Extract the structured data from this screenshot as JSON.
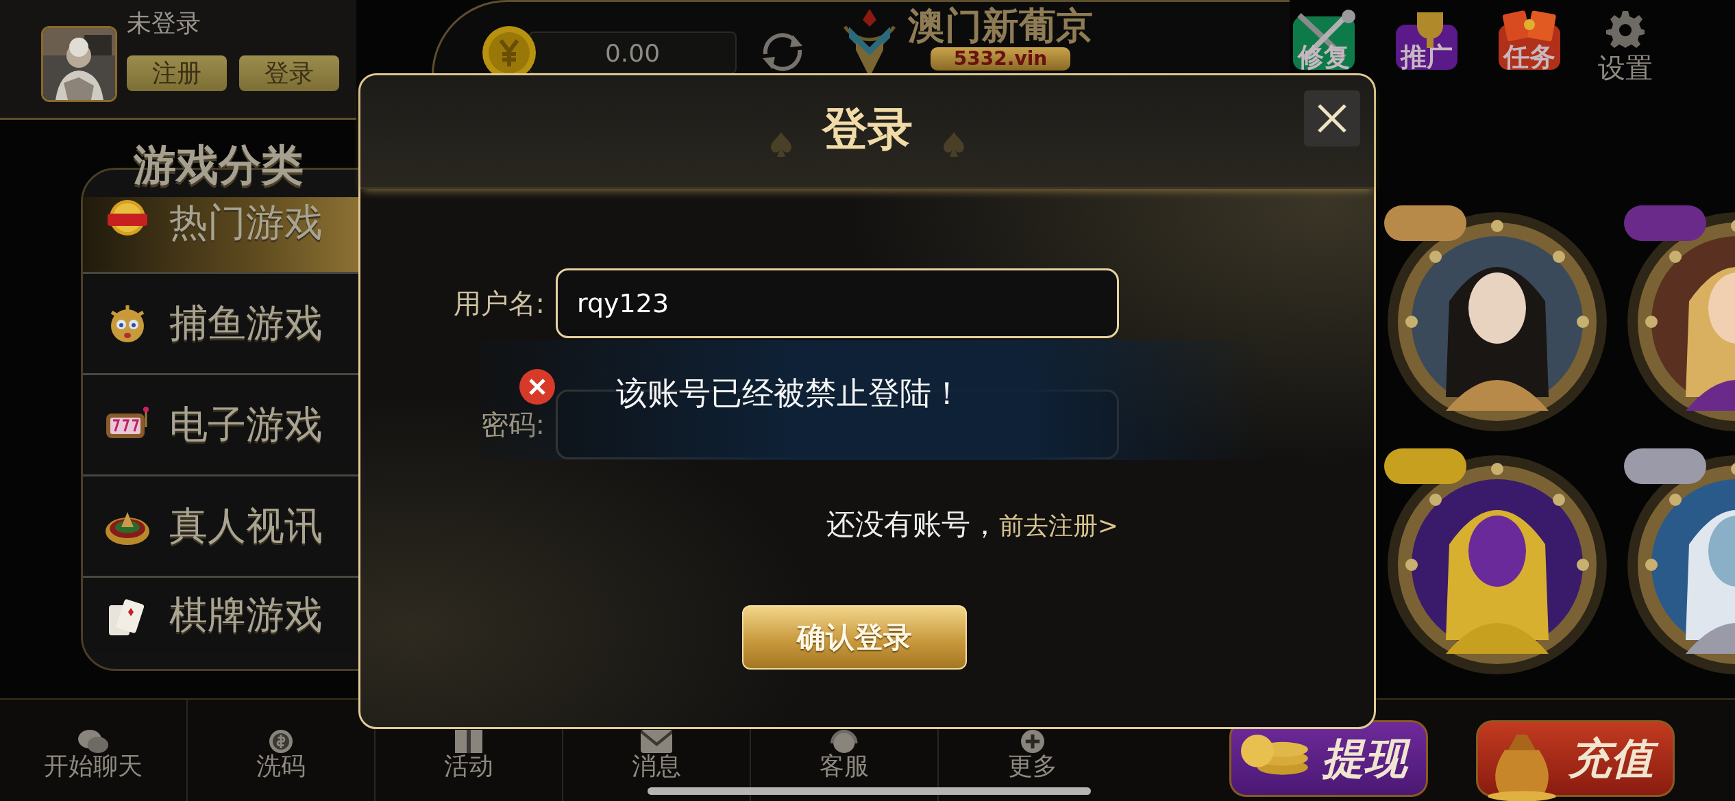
{
  "user": {
    "status": "未登录",
    "buttons": [
      "注册",
      "登录"
    ]
  },
  "balance": {
    "amount": "0.00"
  },
  "brand": {
    "name": "澳门新葡京",
    "domain": "5332.vin"
  },
  "top_actions": [
    {
      "label": "修复",
      "kind": "repair"
    },
    {
      "label": "推广",
      "kind": "promote"
    },
    {
      "label": "任务",
      "kind": "task"
    },
    {
      "label": "设置",
      "kind": "settings"
    }
  ],
  "categories": {
    "title": "游戏分类",
    "items": [
      {
        "label": "热门游戏",
        "kind": "hot",
        "selected": true
      },
      {
        "label": "捕鱼游戏",
        "kind": "fish",
        "selected": false
      },
      {
        "label": "电子游戏",
        "kind": "slot",
        "selected": false
      },
      {
        "label": "真人视讯",
        "kind": "roulette",
        "selected": false
      },
      {
        "label": "棋牌游戏",
        "kind": "cards",
        "selected": false
      }
    ]
  },
  "bottom_nav": [
    {
      "label": "开始聊天",
      "kind": "chat"
    },
    {
      "label": "洗码",
      "kind": "coin"
    },
    {
      "label": "活动",
      "kind": "gift"
    },
    {
      "label": "消息",
      "kind": "mail"
    },
    {
      "label": "客服",
      "kind": "service"
    },
    {
      "label": "更多",
      "kind": "more"
    }
  ],
  "wallet_buttons": [
    {
      "label": "提现",
      "kind": "withdraw"
    },
    {
      "label": "充值",
      "kind": "deposit"
    }
  ],
  "login_dialog": {
    "title": "登录",
    "fields": [
      {
        "label": "用户名:",
        "value": "rqy123"
      },
      {
        "label": "密码:"
      }
    ],
    "prompt": "还没有账号，",
    "register_link": "前去注册>",
    "submit": "确认登录"
  },
  "toast": {
    "kind": "error",
    "message": "该账号已经被禁止登陆！"
  }
}
